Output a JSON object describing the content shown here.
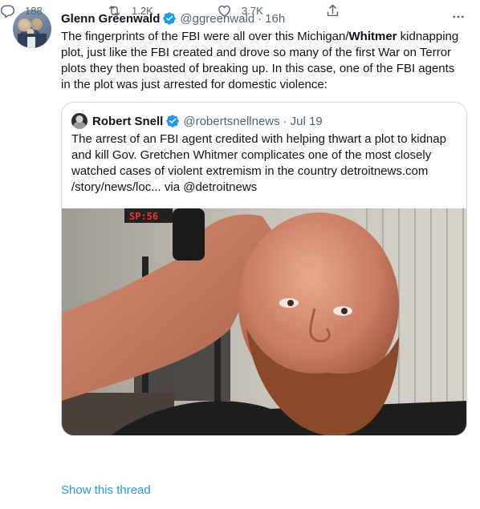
{
  "tweet": {
    "author": {
      "display_name": "Glenn Greenwald",
      "handle": "@ggreenwald",
      "time": "16h",
      "verified_icon": "verified-badge-icon"
    },
    "separator": "·",
    "text_before": "The fingerprints of the FBI were all over this Michigan/",
    "text_bold": "Whitmer",
    "text_after": " kidnapping plot, just like the FBI created and drove so many of the first War on Terror plots they then boasted of breaking up. In this case, one of the FBI agents in the plot was just arrested for domestic violence:",
    "more_icon": "more-options-icon"
  },
  "quote": {
    "author": {
      "display_name": "Robert Snell",
      "handle": "@robertsnellnews",
      "time": "Jul 19"
    },
    "text": "The arrest of an FBI agent credited with helping thwart a plot to kidnap and kill Gov. Gretchen Whitmer complicates one of the most closely watched cases of violent extremism in the country detroitnews.com /story/news/loc... via @detroitnews",
    "media": {
      "description_icon": "selfie-photo",
      "wall_sign_text": "SP:56"
    }
  },
  "actions": {
    "reply_count": "188",
    "retweet_count": "1.2K",
    "like_count": "3.7K"
  },
  "show_thread_label": "Show this thread",
  "colors": {
    "accent": "#1d9bf0",
    "text": "#0f1419",
    "secondary_text": "#536471",
    "border": "#cfd9de"
  }
}
